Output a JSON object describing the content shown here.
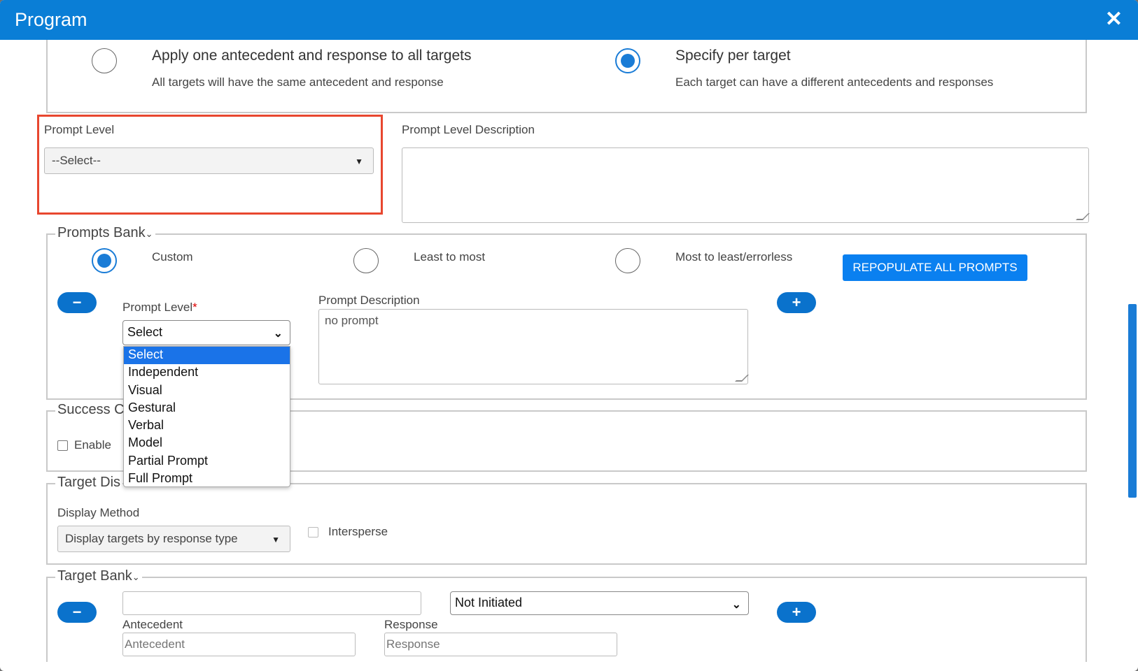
{
  "window": {
    "title": "Program"
  },
  "scope": {
    "option1_title": "Apply one antecedent and response to all targets",
    "option1_desc": "All targets will have the same antecedent and response",
    "option2_title": "Specify per target",
    "option2_desc": "Each target can have a different antecedents and responses",
    "selected": "option2"
  },
  "prompt_level": {
    "label": "Prompt Level",
    "value": "--Select--",
    "description_label": "Prompt Level Description",
    "description_value": ""
  },
  "prompts_bank": {
    "legend": "Prompts Bank",
    "options": [
      "Custom",
      "Least to most",
      "Most to least/errorless"
    ],
    "selected": "Custom",
    "repopulate_label": "REPOPULATE ALL PROMPTS",
    "row": {
      "level_label": "Prompt Level",
      "required_mark": "*",
      "level_value": "Select",
      "description_label": "Prompt Description",
      "description_value": "no prompt"
    },
    "dropdown_options": [
      "Select",
      "Independent",
      "Visual",
      "Gestural",
      "Verbal",
      "Model",
      "Partial Prompt",
      "Full Prompt"
    ],
    "dropdown_selected": "Select"
  },
  "success_criteria": {
    "legend_visible": "Success C",
    "enable_label": "Enable",
    "enabled": false
  },
  "target_display": {
    "legend_visible": "Target Dis",
    "method_label": "Display Method",
    "method_value": "Display targets by response type",
    "intersperse_label": "Intersperse",
    "intersperse": false
  },
  "target_bank": {
    "legend": "Target Bank",
    "target_value": "",
    "status_value": "Not Initiated",
    "antecedent_label": "Antecedent",
    "antecedent_placeholder": "Antecedent",
    "response_label": "Response",
    "response_placeholder": "Response"
  },
  "icons": {
    "close": "close-icon",
    "minus": "minus-icon",
    "plus": "plus-icon",
    "caret": "caret-down-icon"
  },
  "colors": {
    "titlebar": "#0a7ed6",
    "accent": "#1a7cd6",
    "highlight": "#e8472f",
    "button": "#0a80f0"
  }
}
